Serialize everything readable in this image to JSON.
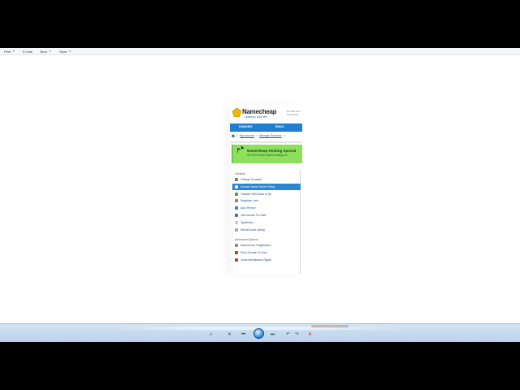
{
  "toolbar": {
    "items": [
      {
        "label": "Print"
      },
      {
        "label": "E-mail"
      },
      {
        "label": "Burn"
      },
      {
        "label": "Open"
      }
    ]
  },
  "page": {
    "logo": {
      "name": "Namecheap",
      "tagline": "Address your life!",
      "side_line1": "Domain Sea",
      "side_line2": "Generation"
    },
    "nav": {
      "items": [
        "DOMAINS",
        "EMAIL"
      ]
    },
    "breadcrumb": {
      "sep": ">",
      "account": "My Account",
      "manage": "Manage Domains",
      "trail": ">"
    },
    "promo": {
      "title": "Namecheap Hosting Special",
      "subtitle": "Get 50% off our shared hosting to u"
    },
    "menu": {
      "general_heading": "General",
      "general_items": [
        {
          "label": "Change Contacts",
          "icon_color": "#777777",
          "selected": false
        },
        {
          "label": "Domain Name Server Setup",
          "icon_color": "#f0f0f0",
          "selected": true
        },
        {
          "label": "Transfer DNS Back to Us",
          "icon_color": "#3fa34d",
          "selected": false
        },
        {
          "label": "Registrar Lock",
          "icon_color": "#b07a3a",
          "selected": false
        },
        {
          "label": "Auto Renew",
          "icon_color": "#2e7dd1",
          "selected": false
        },
        {
          "label": "List Domain For Sale",
          "icon_color": "#5a6f8a",
          "selected": false
        },
        {
          "label": "Typefinder",
          "icon_color": "#c8c8c8",
          "selected": false
        },
        {
          "label": "WhoisGuard Listing",
          "icon_color": "#9aa7b6",
          "selected": false
        }
      ],
      "advanced_heading": "Advanced Options",
      "advanced_items": [
        {
          "label": "Nameserver Registration",
          "icon_color": "#8a8a8a",
          "selected": false
        },
        {
          "label": "Push Domain To User",
          "icon_color": "#b53b3b",
          "selected": false
        },
        {
          "label": "Grant Modification Rights",
          "icon_color": "#c0392b",
          "selected": false
        }
      ]
    }
  },
  "player": {
    "controls": [
      "search-icon",
      "prev-icon",
      "play-icon",
      "next-icon",
      "rotate-left-icon",
      "rotate-right-icon",
      "delete-icon"
    ],
    "accent": "#3c8fdb"
  }
}
